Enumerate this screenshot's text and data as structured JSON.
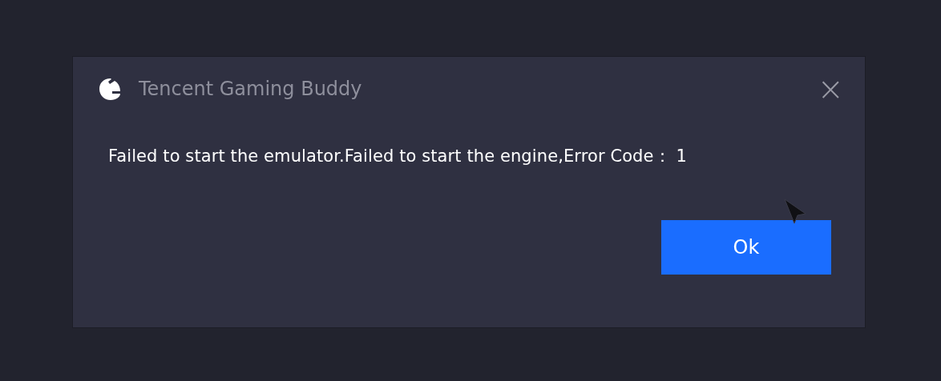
{
  "dialog": {
    "title": "Tencent Gaming Buddy",
    "close": "×",
    "message": "Failed to start the emulator.Failed to start the engine,Error Code： 1",
    "buttons": [
      "Ok"
    ]
  }
}
